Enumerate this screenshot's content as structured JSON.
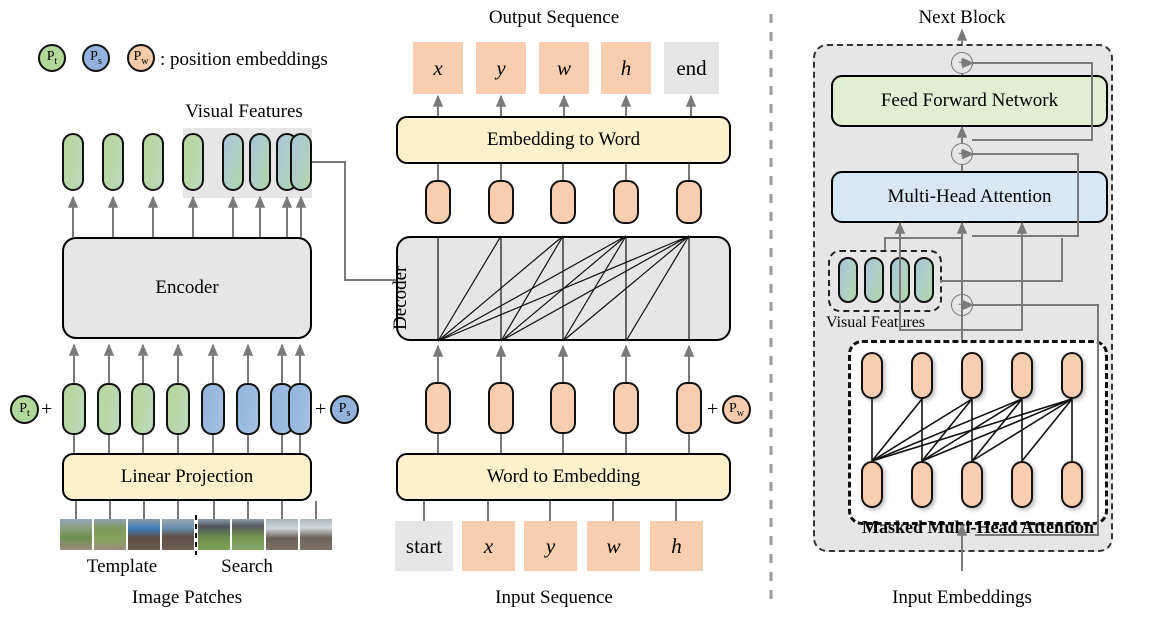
{
  "figure": {
    "title_top_middle": "Output Sequence",
    "title_top_right": "Next Block"
  },
  "legend": {
    "items": [
      {
        "name": "position-embedding-template",
        "letter": "P",
        "sub": "t",
        "color": "#b2d79a"
      },
      {
        "name": "position-embedding-search",
        "letter": "P",
        "sub": "s",
        "color": "#93b3dc"
      },
      {
        "name": "position-embedding-word",
        "letter": "P",
        "sub": "w",
        "color": "#f7caab"
      }
    ],
    "caption": ": position embeddings"
  },
  "left_panel": {
    "visual_features_label": "Visual Features",
    "encoder_label": "Encoder",
    "linear_projection_label": "Linear Projection",
    "template_label": "Template",
    "search_label": "Search",
    "image_patches_label": "Image Patches",
    "plus_left": "+",
    "plus_right": "+",
    "pt_letter": "P",
    "pt_sub": "t",
    "ps_letter": "P",
    "ps_sub": "s",
    "template_token_count": 4,
    "search_token_count": 4,
    "feature_token_count": 8
  },
  "middle_panel": {
    "output_sequence_label": "Output Sequence",
    "output_tokens": [
      {
        "text": "x",
        "style": "italic",
        "color": "#f9cdb0"
      },
      {
        "text": "y",
        "style": "italic",
        "color": "#f9cdb0"
      },
      {
        "text": "w",
        "style": "italic",
        "color": "#f9cdb0"
      },
      {
        "text": "h",
        "style": "italic",
        "color": "#f9cdb0"
      },
      {
        "text": "end",
        "style": "normal",
        "color": "#e6e6e6"
      }
    ],
    "embedding_to_word_label": "Embedding to Word",
    "decoder_label": "Decoder",
    "word_to_embedding_label": "Word to Embedding",
    "input_tokens": [
      {
        "text": "start",
        "style": "normal",
        "color": "#e6e6e6"
      },
      {
        "text": "x",
        "style": "italic",
        "color": "#f9cdb0"
      },
      {
        "text": "y",
        "style": "italic",
        "color": "#f9cdb0"
      },
      {
        "text": "w",
        "style": "italic",
        "color": "#f9cdb0"
      },
      {
        "text": "h",
        "style": "italic",
        "color": "#f9cdb0"
      }
    ],
    "input_sequence_label": "Input Sequence",
    "plus_pw": "+",
    "pw_letter": "P",
    "pw_sub": "w"
  },
  "right_panel": {
    "next_block_label": "Next Block",
    "feed_forward_label": "Feed Forward Network",
    "multi_head_attention_label": "Multi-Head Attention",
    "visual_features_label": "Visual Features",
    "masked_attention_label": "Masked Multi-Head Attention",
    "input_embeddings_label": "Input Embeddings",
    "residual_symbol": "+",
    "visual_feature_count": 4,
    "attention_token_count": 5
  },
  "colors": {
    "green_token": "#b6d5a0",
    "blue_token": "#94b4dd",
    "peach_token": "#f9cdb0",
    "gray_box": "#e6e6e6",
    "yellow_box": "#fdf0cd",
    "green_box": "#e2eed2",
    "blue_box": "#d7e7f5",
    "wire": "#7a7a7a",
    "outline": "#000000"
  }
}
